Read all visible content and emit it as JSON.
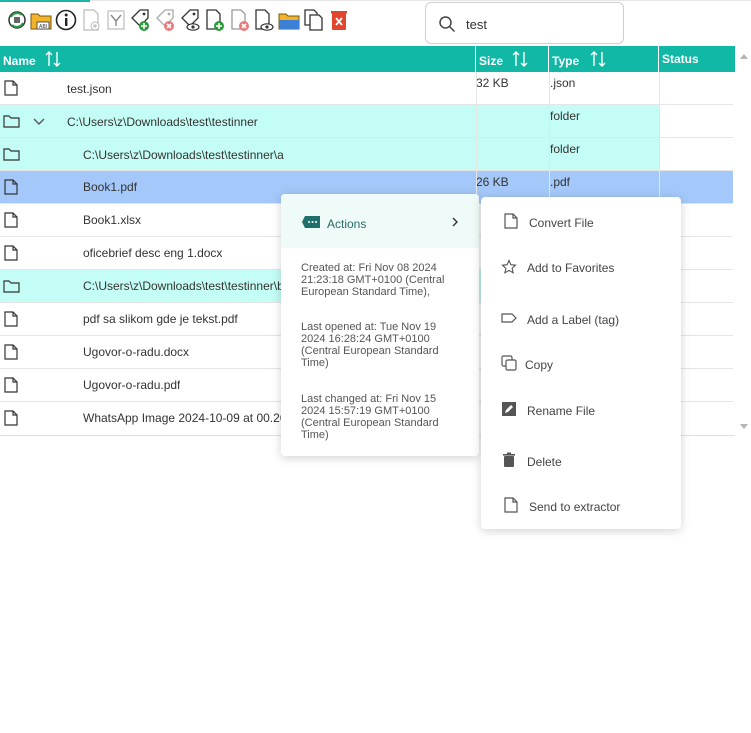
{
  "toolbar": {
    "icons": [
      "sync-icon",
      "folder-abi-icon",
      "info-icon",
      "file-add-icon",
      "filter-icon",
      "tag-add-icon",
      "tag-remove-icon",
      "tag-view-icon",
      "doc-add-icon",
      "doc-remove-icon",
      "doc-view-icon",
      "folder-blue-icon",
      "copy-icon",
      "delete-icon"
    ]
  },
  "search": {
    "value": "test",
    "placeholder": ""
  },
  "table": {
    "headers": {
      "name": "Name",
      "size": "Size",
      "type": "Type",
      "status": "Status"
    },
    "rows": [
      {
        "name": "test.json",
        "size": "32 KB",
        "type": ".json",
        "kind": "file"
      },
      {
        "name": "C:\\Users\\z\\Downloads\\test\\testinner",
        "size": "",
        "type": "folder",
        "kind": "folder"
      },
      {
        "name": "C:\\Users\\z\\Downloads\\test\\testinner\\a",
        "size": "",
        "type": "folder",
        "kind": "folder"
      },
      {
        "name": "Book1.pdf",
        "size": "26 KB",
        "type": ".pdf",
        "kind": "file"
      },
      {
        "name": "Book1.xlsx",
        "size": "",
        "type": "",
        "kind": "file"
      },
      {
        "name": "oficebrief desc eng 1.docx",
        "size": "",
        "type": "",
        "kind": "file"
      },
      {
        "name": "C:\\Users\\z\\Downloads\\test\\testinner\\b",
        "size": "",
        "type": "",
        "kind": "folder"
      },
      {
        "name": "pdf sa slikom gde je tekst.pdf",
        "size": "",
        "type": "",
        "kind": "file"
      },
      {
        "name": "Ugovor-o-radu.docx",
        "size": "",
        "type": "",
        "kind": "file"
      },
      {
        "name": "Ugovor-o-radu.pdf",
        "size": "",
        "type": "",
        "kind": "file"
      },
      {
        "name": "WhatsApp Image 2024-10-09 at 00.26",
        "size": "",
        "type": "",
        "kind": "file"
      }
    ]
  },
  "context_menu": {
    "actions_label": "Actions",
    "created": "Created at: Fri Nov 08 2024 21:23:18 GMT+0100 (Central European Standard Time),",
    "opened": "Last opened at: Tue Nov 19 2024 16:28:24 GMT+0100 (Central European Standard Time)",
    "changed": "Last changed at: Fri Nov 15 2024 15:57:19 GMT+0100 (Central European Standard Time)"
  },
  "submenu": {
    "convert": "Convert File",
    "favorites": "Add to Favorites",
    "label": "Add a Label (tag)",
    "copy": "Copy",
    "rename": "Rename File",
    "delete": "Delete",
    "extractor": "Send to extractor"
  },
  "colors": {
    "header": "#12b8a6",
    "folder_row": "#c4fdf5",
    "selected_row": "#a4c8f9",
    "actions_bg": "#effbf8"
  }
}
